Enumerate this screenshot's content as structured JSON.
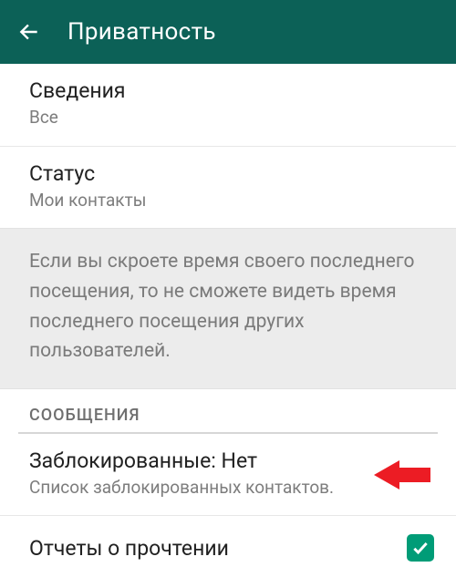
{
  "header": {
    "title": "Приватность"
  },
  "items": {
    "about": {
      "title": "Сведения",
      "value": "Все"
    },
    "status": {
      "title": "Статус",
      "value": "Мои контакты"
    }
  },
  "note": "Если вы скроете время своего последнего посещения, то не сможете видеть время последнего посещения других пользователей.",
  "sections": {
    "messages": "СООБЩЕНИЯ"
  },
  "blocked": {
    "title": "Заблокированные: Нет",
    "subtitle": "Список заблокированных контактов."
  },
  "receipts": {
    "title": "Отчеты о прочтении",
    "checked": true
  },
  "colors": {
    "appbar": "#0c6157",
    "accent": "#009c77",
    "annotation_arrow": "#ec1c24"
  }
}
